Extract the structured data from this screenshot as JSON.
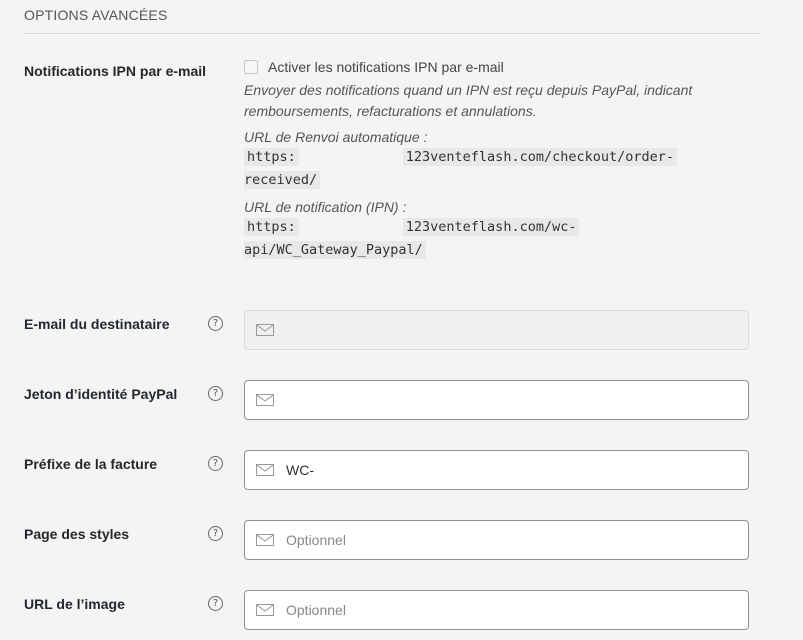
{
  "section": {
    "title": "OPTIONS AVANCÉES"
  },
  "ipn": {
    "label": "Notifications IPN par e-mail",
    "checkbox_label": "Activer les notifications IPN par e-mail",
    "checked": false,
    "description": "Envoyer des notifications quand un IPN est reçu depuis PayPal, indicant remboursements, refacturations et annulations.",
    "return_url_label": "URL de Renvoi automatique :",
    "return_url_part1": "https:",
    "return_url_part2": "123venteflash.com/checkout/order-",
    "return_url_part3": "received/",
    "notify_url_label": "URL de notification (IPN) :",
    "notify_url_part1": "https:",
    "notify_url_part2": "123venteflash.com/wc-",
    "notify_url_part3": "api/WC_Gateway_Paypal/"
  },
  "fields": {
    "receiver_email": {
      "label": "E-mail du destinataire",
      "help": "?",
      "value": "",
      "placeholder": ""
    },
    "identity_token": {
      "label": "Jeton d’identité PayPal",
      "help": "?",
      "value": "",
      "placeholder": ""
    },
    "invoice_prefix": {
      "label": "Préfixe de la facture",
      "help": "?",
      "value": "WC-",
      "placeholder": ""
    },
    "page_style": {
      "label": "Page des styles",
      "help": "?",
      "value": "",
      "placeholder": "Optionnel"
    },
    "image_url": {
      "label": "URL de l’image",
      "help": "?",
      "value": "",
      "placeholder": "Optionnel"
    }
  },
  "icons": {
    "field_icon": "mail-icon",
    "help_icon": "help-icon"
  }
}
